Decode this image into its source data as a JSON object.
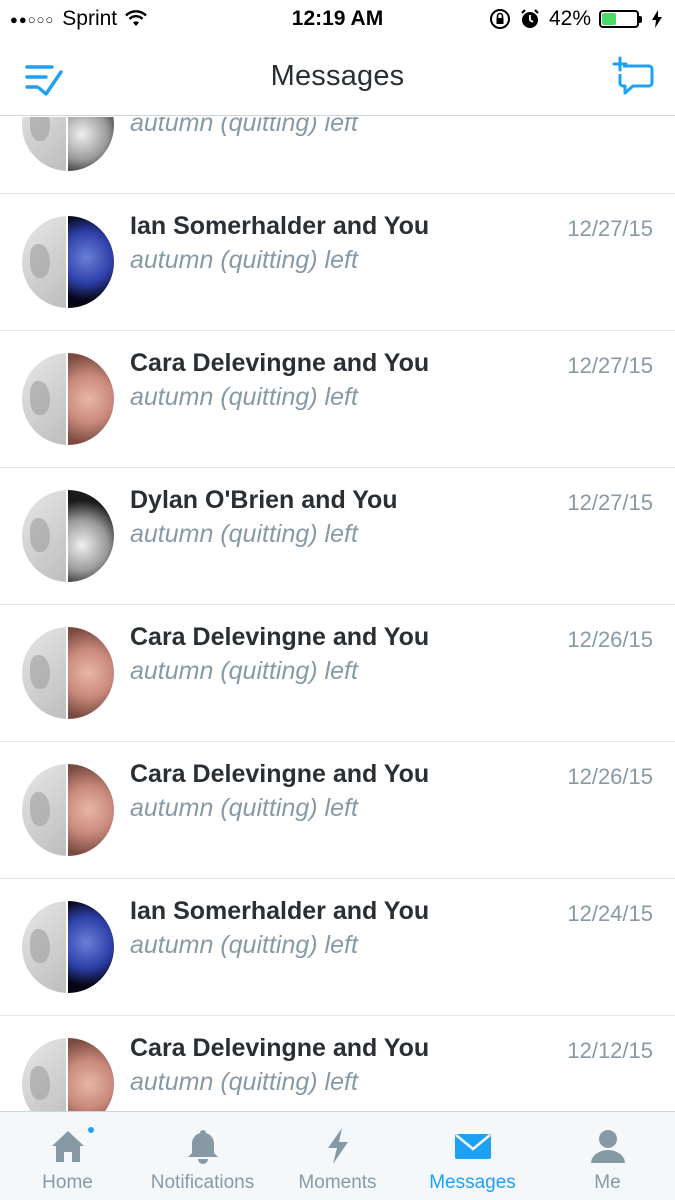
{
  "status_bar": {
    "signal": "●●○○○",
    "carrier": "Sprint",
    "time": "12:19 AM",
    "battery_text": "42%",
    "battery_level": 0.42
  },
  "nav": {
    "title": "Messages"
  },
  "conversations": [
    {
      "title": "",
      "subtitle": "autumn (quitting) left",
      "date": "",
      "avatar": "dylan"
    },
    {
      "title": "Ian Somerhalder and You",
      "subtitle": "autumn (quitting) left",
      "date": "12/27/15",
      "avatar": "ian"
    },
    {
      "title": "Cara Delevingne and You",
      "subtitle": "autumn (quitting) left",
      "date": "12/27/15",
      "avatar": "cara"
    },
    {
      "title": "Dylan O'Brien and You",
      "subtitle": "autumn (quitting) left",
      "date": "12/27/15",
      "avatar": "dylan"
    },
    {
      "title": "Cara Delevingne and You",
      "subtitle": "autumn (quitting) left",
      "date": "12/26/15",
      "avatar": "cara"
    },
    {
      "title": "Cara Delevingne and You",
      "subtitle": "autumn (quitting) left",
      "date": "12/26/15",
      "avatar": "cara"
    },
    {
      "title": "Ian Somerhalder and You",
      "subtitle": "autumn (quitting) left",
      "date": "12/24/15",
      "avatar": "ian"
    },
    {
      "title": "Cara Delevingne and You",
      "subtitle": "autumn (quitting) left",
      "date": "12/12/15",
      "avatar": "cara"
    }
  ],
  "tabs": [
    {
      "label": "Home",
      "icon": "home-icon",
      "active": false
    },
    {
      "label": "Notifications",
      "icon": "bell-icon",
      "active": false
    },
    {
      "label": "Moments",
      "icon": "lightning-icon",
      "active": false
    },
    {
      "label": "Messages",
      "icon": "envelope-icon",
      "active": true
    },
    {
      "label": "Me",
      "icon": "person-icon",
      "active": false
    }
  ],
  "colors": {
    "accent": "#1da1f2",
    "muted": "#8899a6",
    "text": "#292f33"
  }
}
